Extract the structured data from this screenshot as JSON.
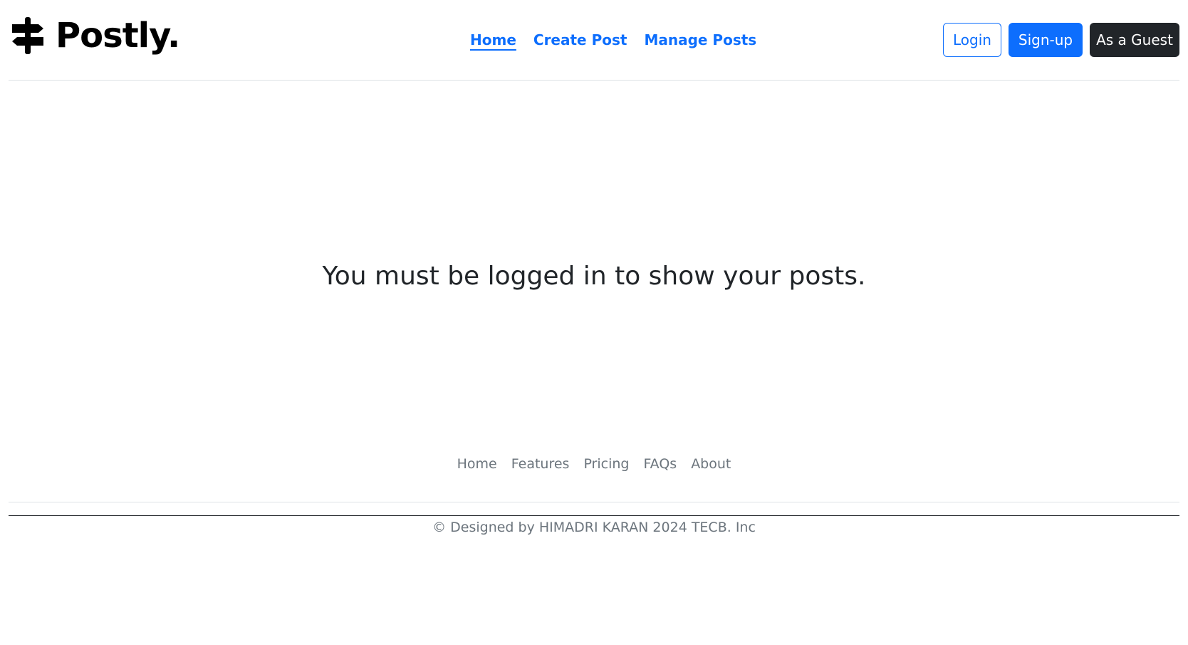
{
  "brand": {
    "name": "Postly.",
    "icon": "signpost-icon"
  },
  "nav": {
    "items": [
      {
        "label": "Home",
        "active": true
      },
      {
        "label": "Create Post",
        "active": false
      },
      {
        "label": "Manage Posts",
        "active": false
      }
    ]
  },
  "actions": {
    "login": "Login",
    "signup": "Sign-up",
    "guest": "As a Guest"
  },
  "main": {
    "message": "You must be logged in to show your posts."
  },
  "footer": {
    "links": [
      "Home",
      "Features",
      "Pricing",
      "FAQs",
      "About"
    ],
    "copyright": "© Designed by HIMADRI KARAN 2024 TECB. Inc"
  },
  "colors": {
    "primary": "#0d6efd",
    "dark": "#212529",
    "muted": "#6c757d",
    "border": "#dee2e6"
  }
}
